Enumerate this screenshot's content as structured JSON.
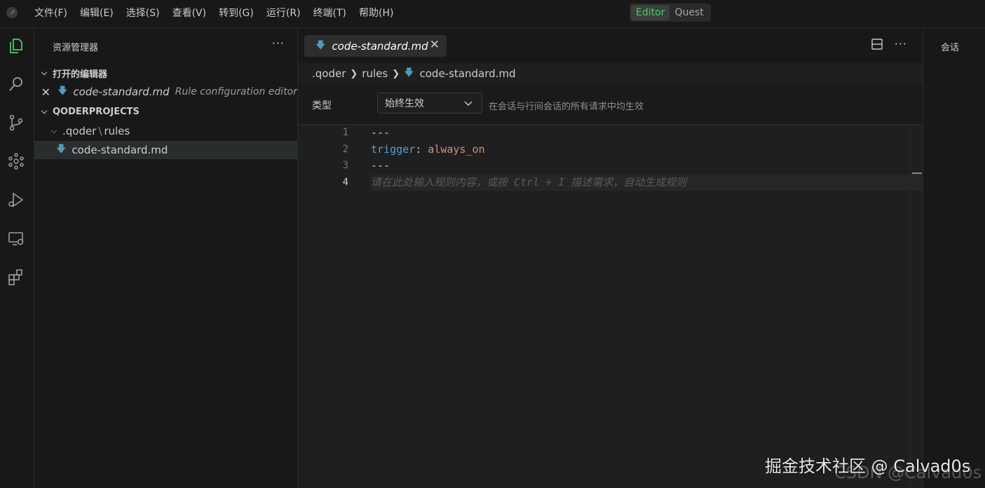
{
  "menu": {
    "items": [
      "文件(F)",
      "编辑(E)",
      "选择(S)",
      "查看(V)",
      "转到(G)",
      "运行(R)",
      "终端(T)",
      "帮助(H)"
    ]
  },
  "mode_switch": {
    "editor": "Editor",
    "quest": "Quest",
    "active": "Editor"
  },
  "activity_bar": {
    "icons": [
      "explorer-icon",
      "search-icon",
      "source-control-icon",
      "agents-icon",
      "run-debug-icon",
      "remote-explorer-icon",
      "extensions-icon"
    ]
  },
  "sidebar": {
    "title": "资源管理器",
    "more": "···",
    "open_editors": {
      "heading": "打开的编辑器",
      "items": [
        {
          "name": "code-standard.md",
          "description": "Rule configuration editor"
        }
      ]
    },
    "project": {
      "heading": "QODERPROJECTS",
      "folder_parts": [
        ".qoder",
        "rules"
      ],
      "file": "code-standard.md"
    }
  },
  "editor": {
    "tab": {
      "label": "code-standard.md",
      "close": "✕"
    },
    "more": "···",
    "breadcrumb": [
      ".qoder",
      "rules",
      "code-standard.md"
    ],
    "rule": {
      "type_label": "类型",
      "type_value": "始终生效",
      "hint": "在会话与行间会话的所有请求中均生效"
    },
    "lines": [
      {
        "number": "1",
        "tokens": [
          {
            "text": "---",
            "kind": "plain"
          }
        ]
      },
      {
        "number": "2",
        "tokens": [
          {
            "text": "trigger",
            "kind": "key"
          },
          {
            "text": ": ",
            "kind": "plain"
          },
          {
            "text": "always_on",
            "kind": "val"
          }
        ]
      },
      {
        "number": "3",
        "tokens": [
          {
            "text": "---",
            "kind": "plain"
          }
        ]
      },
      {
        "number": "4",
        "tokens": [
          {
            "text": "请在此处输入规则内容，或按 Ctrl + I 描述需求，自动生成规则",
            "kind": "ph"
          }
        ]
      }
    ]
  },
  "right_panel": {
    "title": "会话"
  },
  "watermark": {
    "main": "掘金技术社区 @ Calvad0s",
    "secondary": "CSDN @Calvad0s"
  }
}
